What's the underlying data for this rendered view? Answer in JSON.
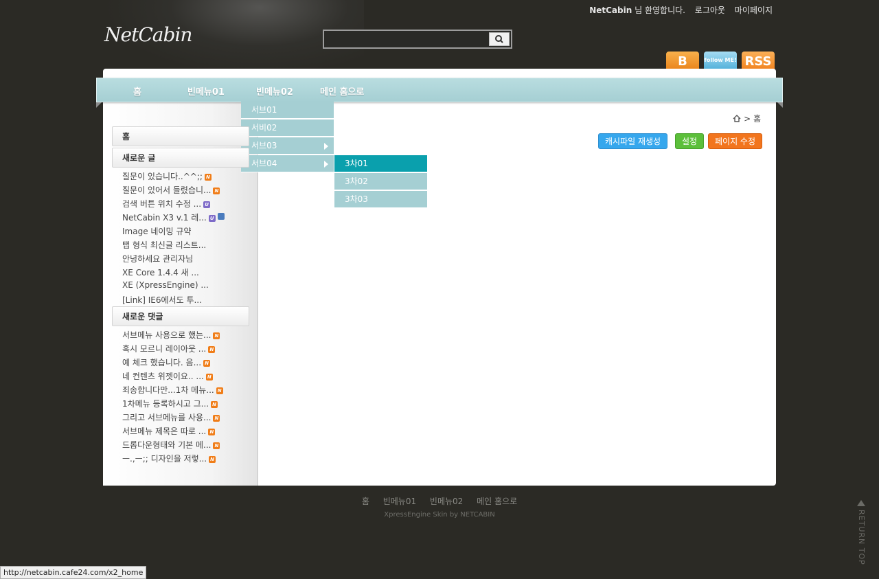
{
  "header": {
    "logo": "NetCabin",
    "user_name": "NetCabin",
    "welcome_suffix": "님 환영합니다.",
    "logout": "로그아웃",
    "mypage": "마이페이지",
    "search_placeholder": "",
    "sns": [
      {
        "name": "blog",
        "label": "B"
      },
      {
        "name": "twitter",
        "label": "follow ME!"
      },
      {
        "name": "rss",
        "label": "RSS"
      }
    ]
  },
  "gnb": {
    "items": [
      "홈",
      "빈메뉴01",
      "빈메뉴02",
      "메인 홈으로"
    ],
    "submenu": [
      {
        "label": "서브01",
        "has_children": false
      },
      {
        "label": "서비02",
        "has_children": false
      },
      {
        "label": "서브03",
        "has_children": true
      },
      {
        "label": "서브04",
        "has_children": true
      }
    ],
    "third_menu": [
      {
        "label": "3차01",
        "active": true
      },
      {
        "label": "3차02",
        "active": false
      },
      {
        "label": "3차03",
        "active": false
      }
    ]
  },
  "breadcrumb": {
    "home_icon": "home-icon",
    "sep": ">",
    "current": "홈"
  },
  "actions": {
    "cache": "캐시파일 재생성",
    "settings": "설정",
    "edit": "페이지 수정"
  },
  "sidebar": {
    "home": "홈",
    "new_posts_title": "새로운 글",
    "new_posts": [
      {
        "text": "질문이 있습니다..^^;;",
        "badges": [
          "N"
        ]
      },
      {
        "text": "질문이 있어서 들렸습니...",
        "badges": [
          "N"
        ]
      },
      {
        "text": "검색 버튼 위치 수정 ...",
        "badges": [
          "U"
        ]
      },
      {
        "text": "NetCabin X3 v.1 레...",
        "badges": [
          "U",
          "file"
        ]
      },
      {
        "text": "Image 네이밍 규약",
        "badges": []
      },
      {
        "text": "탭 형식 최신글 리스트...",
        "badges": []
      },
      {
        "text": "안녕하세요 관리자님",
        "badges": []
      },
      {
        "text": "XE Core 1.4.4 새 ...",
        "badges": []
      },
      {
        "text": "XE (XpressEngine) ...",
        "badges": []
      },
      {
        "text": "[Link] IE6에서도 투...",
        "badges": []
      }
    ],
    "new_comments_title": "새로운 댓글",
    "new_comments": [
      {
        "text": "서브메뉴 사용으로 했는...",
        "badges": [
          "N"
        ]
      },
      {
        "text": "혹시 모르니 레이아웃 ...",
        "badges": [
          "N"
        ]
      },
      {
        "text": "예 체크 했습니다. 음...",
        "badges": [
          "N"
        ]
      },
      {
        "text": "네 컨텐츠 위젯이요.. ...",
        "badges": [
          "N"
        ]
      },
      {
        "text": "죄송합니다만...1차 메뉴...",
        "badges": [
          "N"
        ]
      },
      {
        "text": "1차메뉴 등록하시고 그...",
        "badges": [
          "N"
        ]
      },
      {
        "text": "그리고 서브메뉴를 사용...",
        "badges": [
          "N"
        ]
      },
      {
        "text": "서브메뉴 제목은 따로 ...",
        "badges": [
          "N"
        ]
      },
      {
        "text": "드롭다운형태와 기본 메...",
        "badges": [
          "N"
        ]
      },
      {
        "text": "ㅡ.,ㅡ;; 디자인을 저렇...",
        "badges": [
          "N"
        ]
      }
    ]
  },
  "footer": {
    "menu": [
      "홈",
      "빈메뉴01",
      "빈메뉴02",
      "메인 홈으로"
    ],
    "copyright": "XpressEngine Skin by NETCABIN",
    "return_top": "RETURN TOP"
  },
  "status_url": "http://netcabin.cafe24.com/x2_home"
}
